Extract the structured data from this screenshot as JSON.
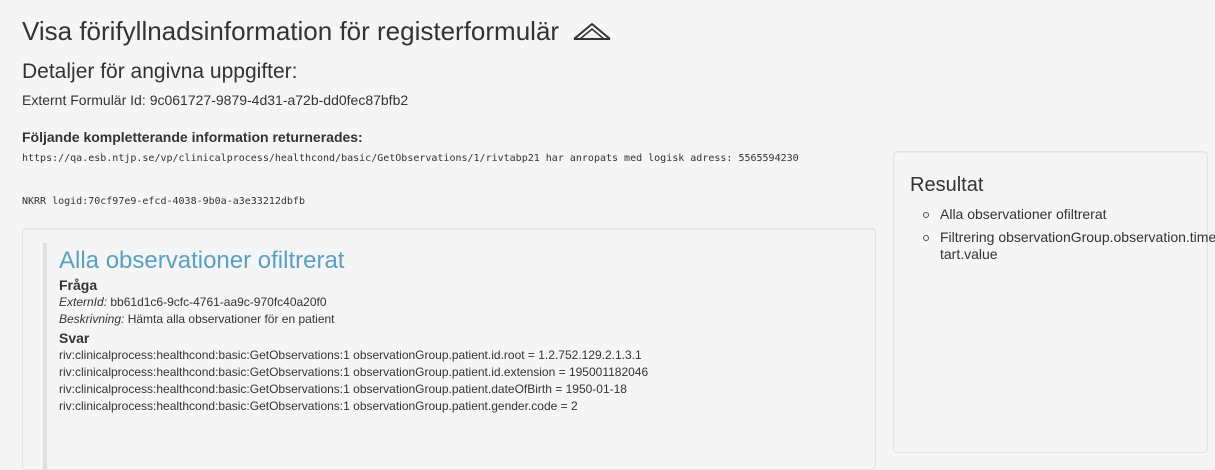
{
  "header": {
    "title": "Visa förifyllnadsinformation för registerformulär",
    "subtitle": "Detaljer för angivna uppgifter:",
    "form_id_label": "Externt Formulär Id:",
    "form_id_value": "9c061727-9879-4d31-a72b-dd0fec87bfb2",
    "collapse_icon": "chevron-up-icon"
  },
  "extra_info": {
    "heading": "Följande kompletterande information returnerades:",
    "url_text": "https://qa.esb.ntjp.se/vp/clinicalprocess/healthcond/basic/GetObservations/1/rivtabp21 har anropats med logisk adress: 5565594230",
    "logid": "NKRR logid:70cf97e9-efcd-4038-9b0a-a3e33212dbfb"
  },
  "panel": {
    "title": "Alla observationer ofiltrerat",
    "question_label": "Fråga",
    "external_id_label": "ExternId:",
    "external_id_value": "bb61d1c6-9cfc-4761-aa9c-970fc40a20f0",
    "description_label": "Beskrivning:",
    "description_value": "Hämta alla observationer för en patient",
    "answer_label": "Svar",
    "answer_lines": [
      "riv:clinicalprocess:healthcond:basic:GetObservations:1 observationGroup.patient.id.root = 1.2.752.129.2.1.3.1",
      "riv:clinicalprocess:healthcond:basic:GetObservations:1 observationGroup.patient.id.extension = 195001182046",
      "riv:clinicalprocess:healthcond:basic:GetObservations:1 observationGroup.patient.dateOfBirth = 1950-01-18",
      "riv:clinicalprocess:healthcond:basic:GetObservations:1 observationGroup.patient.gender.code = 2"
    ]
  },
  "result": {
    "title": "Resultat",
    "items": [
      "Alla observationer ofiltrerat",
      "Filtrering observationGroup.observation.time.start.value"
    ]
  },
  "colors": {
    "accent": "#5a9fc4",
    "background": "#f5f5f5",
    "text": "#333333"
  }
}
